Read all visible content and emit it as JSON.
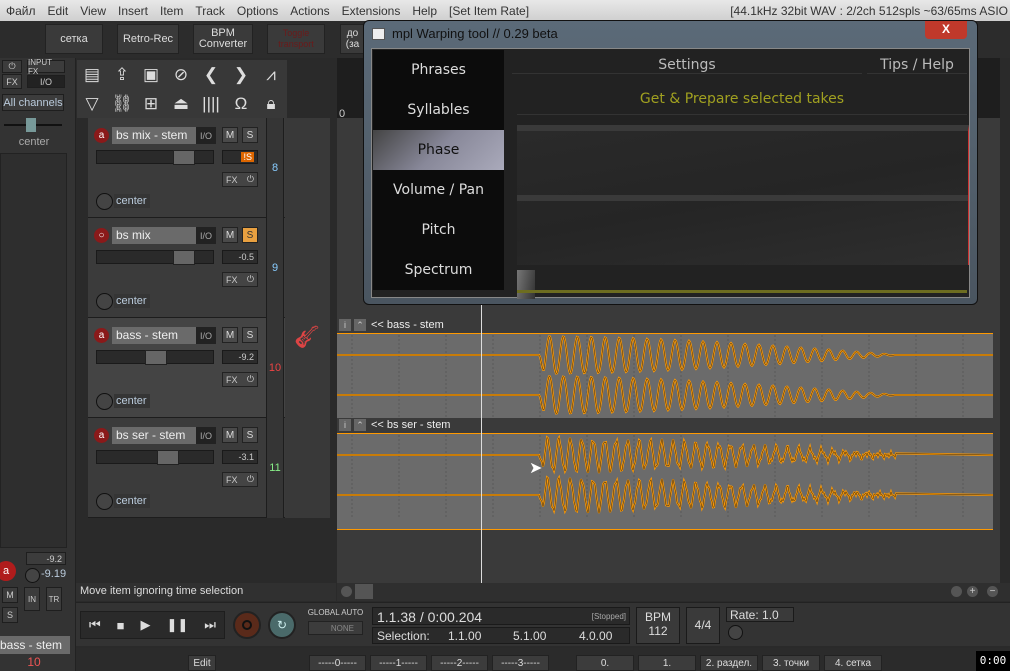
{
  "menu": [
    "Файл",
    "Edit",
    "View",
    "Insert",
    "Item",
    "Track",
    "Options",
    "Actions",
    "Extensions",
    "Help",
    "[Set Item Rate]"
  ],
  "menu_info": "[44.1kHz 32bit WAV : 2/2ch 512spls ~63/65ms ASIO",
  "toolbar": {
    "b1": "сетка",
    "b2": "Retro-Rec",
    "b3": "BPM Converter",
    "b4": "Toggle transport",
    "b5": "до (за"
  },
  "left_strip": {
    "power": "⏻",
    "input_fx": "INPUT FX",
    "fx": "FX",
    "io": "I/O",
    "channels": "All channels",
    "pan": "center",
    "vol": "-9.2",
    "vol2": "-9.19",
    "m": "M",
    "s": "S",
    "in": "IN",
    "trm": "TR",
    "track_name": "bass - stem",
    "track_num": "10"
  },
  "tracks": [
    {
      "name": "bs mix - stem",
      "io": "I/O",
      "m": "M",
      "s": "S",
      "vol": "!S",
      "fx": "FX",
      "pan": "center",
      "num": "8",
      "rec": "a"
    },
    {
      "name": "bs mix",
      "io": "I/O",
      "m": "M",
      "s": "S",
      "vol": "-0.5",
      "fx": "FX",
      "pan": "center",
      "num": "9",
      "rec": "○"
    },
    {
      "name": "bass - stem",
      "io": "I/O",
      "m": "M",
      "s": "S",
      "vol": "-9.2",
      "fx": "FX",
      "pan": "center",
      "num": "10",
      "rec": "a"
    },
    {
      "name": "bs ser - stem",
      "io": "I/O",
      "m": "M",
      "s": "S",
      "vol": "-3.1",
      "fx": "FX",
      "pan": "center",
      "num": "11",
      "rec": "a"
    }
  ],
  "items": [
    {
      "label": "<< bass - stem"
    },
    {
      "label": "<< bs ser - stem"
    }
  ],
  "ruler_start": "0",
  "plugin": {
    "title": "mpl Warping tool // 0.29 beta",
    "close": "X",
    "tabs": [
      "Phrases",
      "Syllables",
      "Phase",
      "Volume / Pan",
      "Pitch",
      "Spectrum"
    ],
    "selected_tab": "Phase",
    "settings": "Settings",
    "tips": "Tips / Help",
    "action": "Get & Prepare selected takes",
    "accent": "#a0a020"
  },
  "status": "Move item ignoring time selection",
  "transport": {
    "position": "1.1.38 / 0:00.204",
    "state": "[Stopped]",
    "selection_label": "Selection:",
    "sel_start": "1.1.00",
    "sel_end": "5.1.00",
    "sel_len": "4.0.00",
    "global_auto": "GLOBAL AUTO",
    "auto_mode": "NONE",
    "bpm_label": "BPM",
    "bpm": "112",
    "timesig": "4/4",
    "rate_label": "Rate:",
    "rate": "1.0"
  },
  "bottom": {
    "edit": "Edit",
    "markers": [
      "-----0-----",
      "-----1-----",
      "-----2-----",
      "-----3-----"
    ],
    "buttons": [
      "0.",
      "1.",
      "2. раздел.",
      "3. точки",
      "4. сетка"
    ],
    "clock": "0:00"
  },
  "colors": {
    "waveform": "#ff9900",
    "item_bg": "#6b6b6b",
    "record": "#8a1a1a"
  }
}
